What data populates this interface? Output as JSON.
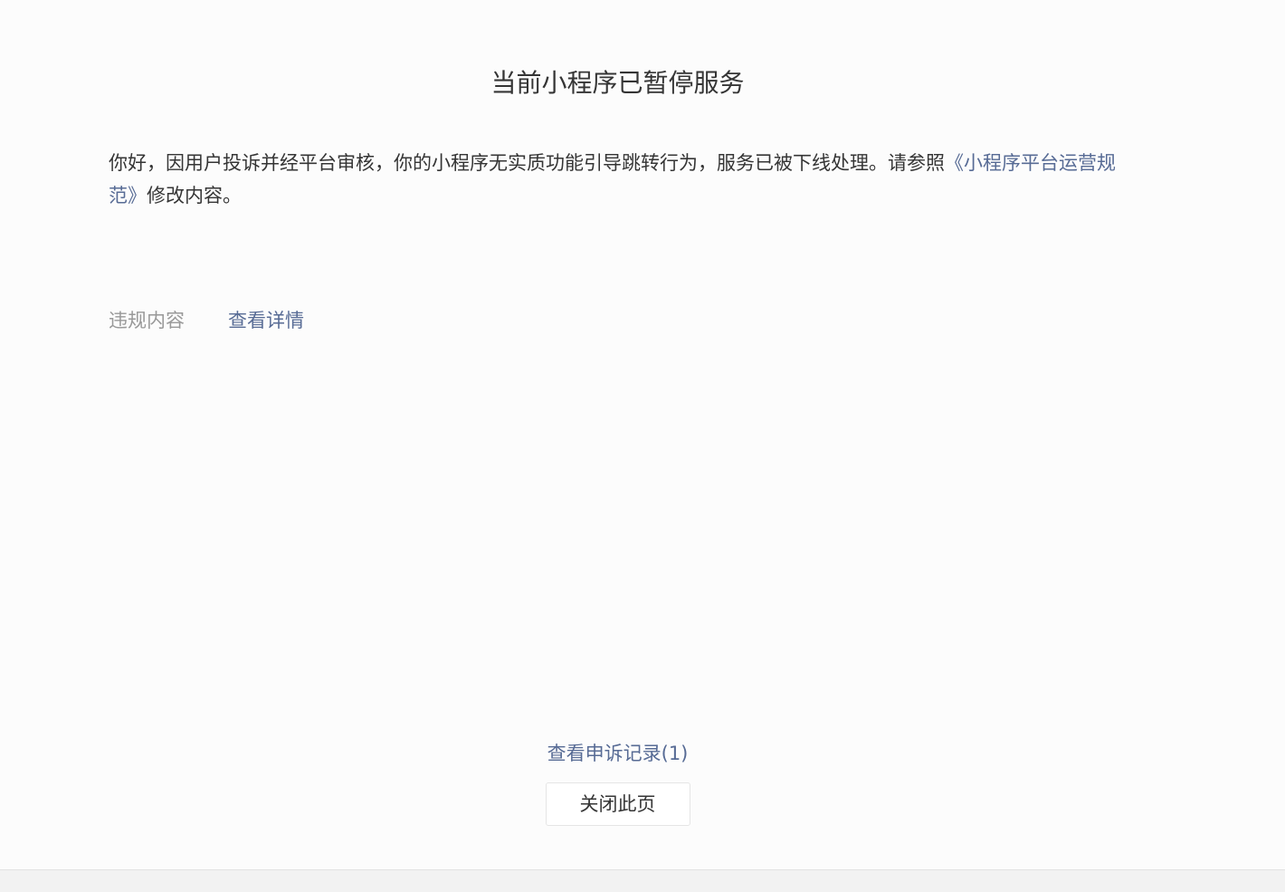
{
  "page": {
    "title": "当前小程序已暂停服务"
  },
  "notice": {
    "text_before": "你好，因用户投诉并经平台审核，你的小程序无实质功能引导跳转行为，服务已被下线处理。请参照",
    "link_text": "《小程序平台运营规范》",
    "text_after": "修改内容。"
  },
  "violation": {
    "label": "违规内容",
    "detail_link": "查看详情"
  },
  "footer": {
    "appeal_link": "查看申诉记录(1)",
    "close_button": "关闭此页"
  },
  "colors": {
    "link": "#576b95",
    "text": "#353535",
    "muted": "#999999"
  }
}
